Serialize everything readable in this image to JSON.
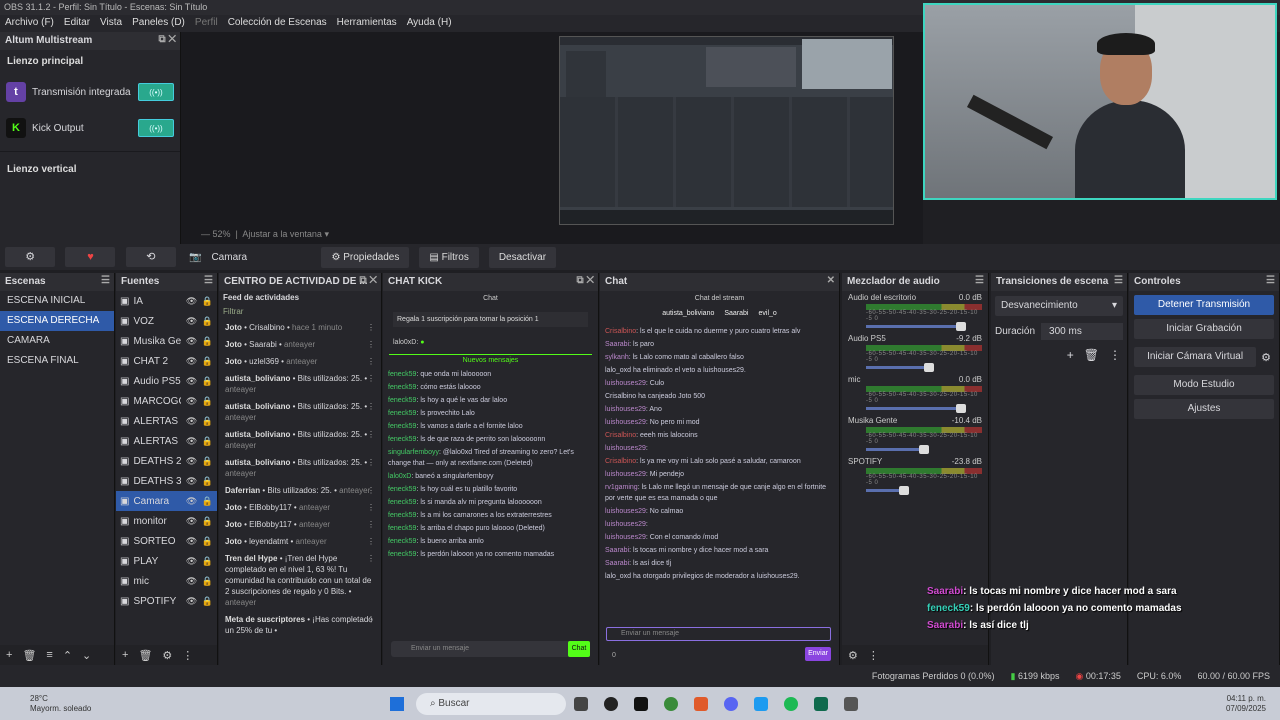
{
  "titlebar": {
    "text": "OBS 31.1.2 - Perfil: Sin Título - Escenas: Sin Título"
  },
  "menu": [
    {
      "label": "Archivo (F)"
    },
    {
      "label": "Editar"
    },
    {
      "label": "Vista"
    },
    {
      "label": "Paneles (D)"
    },
    {
      "label": "Perfil"
    },
    {
      "label": "Colección de Escenas"
    },
    {
      "label": "Herramientas"
    },
    {
      "label": "Ayuda (H)"
    }
  ],
  "multistream": {
    "title": "Altum Multistream",
    "main_canvas": "Lienzo principal",
    "outputs": [
      {
        "label": "Transmisión integrada",
        "icon": "twitch-icon",
        "color": "#6441a5"
      },
      {
        "label": "Kick Output",
        "icon": "kick-icon",
        "color": "#53fc18"
      }
    ],
    "vertical_canvas": "Lienzo vertical"
  },
  "preview": {
    "zoom": "52%",
    "fit": "Ajustar a la ventana"
  },
  "source_toolbar": {
    "source": "Camara",
    "props": "Propiedades",
    "filters": "Filtros",
    "deactivate": "Desactivar"
  },
  "scenes": {
    "title": "Escenas",
    "items": [
      "ESCENA INICIAL",
      "ESCENA DERECHA",
      "CAMARA",
      "ESCENA FINAL"
    ],
    "selected": 1
  },
  "sources": {
    "title": "Fuentes",
    "items": [
      "IA",
      "VOZ",
      "Musika Ge",
      "CHAT 2",
      "Audio PS5",
      "MARCOGO",
      "ALERTAS I",
      "ALERTAS 1",
      "DEATHS 2",
      "DEATHS 3",
      "Camara",
      "monitor",
      "SORTEO",
      "PLAY",
      "mic",
      "SPOTIFY"
    ],
    "selected": 10
  },
  "activity": {
    "title": "CENTRO DE ACTIVIDAD DE ...",
    "subtitle": "Feed de actividades",
    "filter": "Filtrar",
    "items": [
      {
        "user": "Joto",
        "text": "Crisalbino",
        "ago": "hace 1 minuto"
      },
      {
        "user": "Joto",
        "text": "Saarabi",
        "ago": "anteayer"
      },
      {
        "user": "Joto",
        "text": "uzlel369",
        "ago": "anteayer"
      },
      {
        "user": "autista_boliviano",
        "text": "Bits utilizados: 25.",
        "ago": "anteayer"
      },
      {
        "user": "autista_boliviano",
        "text": "Bits utilizados: 25.",
        "ago": "anteayer"
      },
      {
        "user": "autista_boliviano",
        "text": "Bits utilizados: 25.",
        "ago": "anteayer"
      },
      {
        "user": "autista_boliviano",
        "text": "Bits utilizados: 25.",
        "ago": "anteayer"
      },
      {
        "user": "Daferrian",
        "text": "Bits utilizados: 25.",
        "ago": "anteayer"
      },
      {
        "user": "Joto",
        "text": "ElBobby117",
        "ago": "anteayer"
      },
      {
        "user": "Joto",
        "text": "ElBobby117",
        "ago": "anteayer"
      },
      {
        "user": "Joto",
        "text": "leyendatmt",
        "ago": "anteayer"
      },
      {
        "user": "Tren del Hype",
        "text": "¡Tren del Hype completado en el nivel 1, 63 %! Tu comunidad ha contribuido con un total de 2 suscripciones de regalo y 0 Bits.",
        "ago": "anteayer"
      },
      {
        "user": "Meta de suscriptores",
        "text": "¡Has completado un 25% de tu",
        "ago": ""
      }
    ]
  },
  "chatkick": {
    "title": "CHAT KICK",
    "header": "Chat",
    "gift": "Regala 1 suscripción para tomar la posición 1",
    "pinned": "lalo0xD:",
    "newmsgs": "Nuevos mensajes",
    "lines": [
      {
        "u": "feneck59",
        "t": "que onda mi lalooooon"
      },
      {
        "u": "feneck59",
        "t": "cómo estás laloooo"
      },
      {
        "u": "feneck59",
        "t": "ls hoy a qué le vas dar laloo"
      },
      {
        "u": "feneck59",
        "t": "ls provechito Lalo"
      },
      {
        "u": "feneck59",
        "t": "ls vamos a darle a el fornite laloo"
      },
      {
        "u": "feneck59",
        "t": "ls de que raza de perrito son lalooooonn"
      },
      {
        "u": "singularfemboyy",
        "t": "@lalo0xd Tired of streaming to zero? Let's change that — only at nextfame.com (Deleted)"
      },
      {
        "u": "lalo0xD",
        "t": "baneó a singularfemboyy"
      },
      {
        "u": "feneck59",
        "t": "ls hoy cuál es tu platillo favorito"
      },
      {
        "u": "feneck59",
        "t": "ls si manda alv mi pregunta laloooooon"
      },
      {
        "u": "feneck59",
        "t": "ls a mi los camarones a los extraterrestres"
      },
      {
        "u": "feneck59",
        "t": "ls arriba el chapo puro laloooo (Deleted)"
      },
      {
        "u": "feneck59",
        "t": "ls bueno arriba amlo"
      },
      {
        "u": "feneck59",
        "t": "ls perdón lalooon ya no comento mamadas"
      }
    ],
    "input": "Enviar un mensaje",
    "send": "Chat"
  },
  "chat": {
    "title": "Chat",
    "header": "Chat del stream",
    "users": [
      "autista_boliviano",
      "Saarabi",
      "evil_o"
    ],
    "lines": [
      {
        "u": "Crisalbino",
        "t": "ls el que le cuida no duerme y puro cuatro letras alv"
      },
      {
        "u": "Saarabi",
        "t": "ls paro"
      },
      {
        "u": "sylkanh",
        "t": "ls Lalo como mato al caballero falso"
      },
      {
        "u": "",
        "t": "lalo_oxd ha eliminado el veto a luishouses29."
      },
      {
        "u": "luishouses29",
        "t": "Culo"
      },
      {
        "u": "",
        "t": "Crisalbino ha canjeado Joto 500"
      },
      {
        "u": "luishouses29",
        "t": "Ano"
      },
      {
        "u": "luishouses29",
        "t": "No pero mi mod"
      },
      {
        "u": "Crisalbino",
        "t": "eeeh mis lalocoins"
      },
      {
        "u": "luishouses29",
        "t": ""
      },
      {
        "u": "Crisalbino",
        "t": "ls ya me voy mi Lalo solo pasé a saludar, camaroon"
      },
      {
        "u": "luishouses29",
        "t": "Mi pendejo"
      },
      {
        "u": "rv1gaming",
        "t": "ls Lalo me llegó un mensaje de que canje algo en el fortnite por verte que es esa mamada o que"
      },
      {
        "u": "luishouses29",
        "t": "No calmao"
      },
      {
        "u": "luishouses29",
        "t": ""
      },
      {
        "u": "luishouses29",
        "t": "Con el comando /mod"
      },
      {
        "u": "Saarabi",
        "t": "ls tocas mi nombre y dice hacer mod a sara"
      },
      {
        "u": "Saarabi",
        "t": "ls así dice tlj"
      },
      {
        "u": "",
        "t": "lalo_oxd ha otorgado privilegios de moderador a luishouses29."
      }
    ],
    "input": "Enviar un mensaje",
    "send": "Enviar",
    "counter": "0"
  },
  "mixer": {
    "title": "Mezclador de audio",
    "scale": "-60-55-50-45-40-35-30-25-20-15-10 -5 0",
    "channels": [
      {
        "name": "Audio del escritorio",
        "db": "0.0 dB",
        "level": 0.88
      },
      {
        "name": "Audio PS5",
        "db": "-9.2 dB",
        "level": 0.6
      },
      {
        "name": "mic",
        "db": "0.0 dB",
        "level": 0.88
      },
      {
        "name": "Musika Gente",
        "db": "-10.4 dB",
        "level": 0.55
      },
      {
        "name": "SPOTIFY",
        "db": "-23.8 dB",
        "level": 0.38
      }
    ]
  },
  "transitions": {
    "title": "Transiciones de escena",
    "type": "Desvanecimiento",
    "duration_label": "Duración",
    "duration": "300 ms"
  },
  "controls": {
    "title": "Controles",
    "buttons": [
      "Detener Transmisión",
      "Iniciar Grabación",
      "Iniciar Cámara Virtual",
      "Modo Estudio",
      "Ajustes"
    ]
  },
  "status": {
    "dropped": "Fotogramas Perdidos 0 (0.0%)",
    "kbps": "6199 kbps",
    "time": "00:17:35",
    "cpu": "CPU: 6.0%",
    "fps": "60.00 / 60.00 FPS"
  },
  "overlay": [
    {
      "u": "Saarabi",
      "t": ": ls tocas mi nombre y dice hacer mod a sara",
      "c": "#d14bd1"
    },
    {
      "u": "feneck59",
      "t": ": ls perdón lalooon ya no comento mamadas",
      "c": "#35d0b8"
    },
    {
      "u": "Saarabi",
      "t": ": ls así dice tlj",
      "c": "#d14bd1"
    }
  ],
  "taskbar": {
    "temp": "28°C",
    "weather": "Mayorm. soleado",
    "search": "Buscar",
    "time": "04:11 p. m.",
    "date": "07/09/2025"
  }
}
